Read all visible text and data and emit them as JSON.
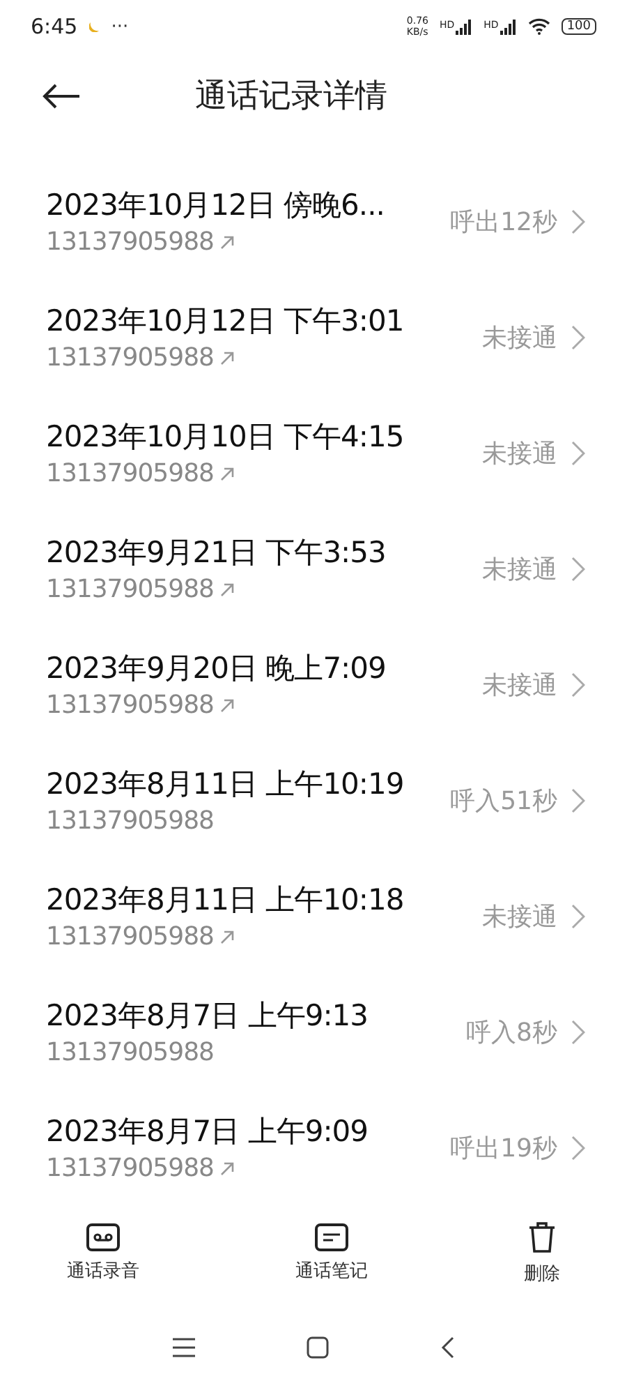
{
  "status_bar": {
    "time": "6:45",
    "more": "···",
    "speed_value": "0.76",
    "speed_unit": "KB/s",
    "signal_labels": [
      "HD",
      "HD"
    ],
    "battery": "100"
  },
  "header": {
    "title": "通话记录详情"
  },
  "calls": [
    {
      "datetime": "2023年10月12日 傍晚6...",
      "number": "13137905988",
      "outgoing": true,
      "result": "呼出12秒"
    },
    {
      "datetime": "2023年10月12日 下午3:01",
      "number": "13137905988",
      "outgoing": true,
      "result": "未接通"
    },
    {
      "datetime": "2023年10月10日 下午4:15",
      "number": "13137905988",
      "outgoing": true,
      "result": "未接通"
    },
    {
      "datetime": "2023年9月21日 下午3:53",
      "number": "13137905988",
      "outgoing": true,
      "result": "未接通"
    },
    {
      "datetime": "2023年9月20日 晚上7:09",
      "number": "13137905988",
      "outgoing": true,
      "result": "未接通"
    },
    {
      "datetime": "2023年8月11日 上午10:19",
      "number": "13137905988",
      "outgoing": false,
      "result": "呼入51秒"
    },
    {
      "datetime": "2023年8月11日 上午10:18",
      "number": "13137905988",
      "outgoing": true,
      "result": "未接通"
    },
    {
      "datetime": "2023年8月7日 上午9:13",
      "number": "13137905988",
      "outgoing": false,
      "result": "呼入8秒"
    },
    {
      "datetime": "2023年8月7日 上午9:09",
      "number": "13137905988",
      "outgoing": true,
      "result": "呼出19秒"
    }
  ],
  "actions": [
    {
      "kind": "recording",
      "label": "通话录音"
    },
    {
      "kind": "note",
      "label": "通话笔记"
    },
    {
      "kind": "delete",
      "label": "删除"
    }
  ]
}
